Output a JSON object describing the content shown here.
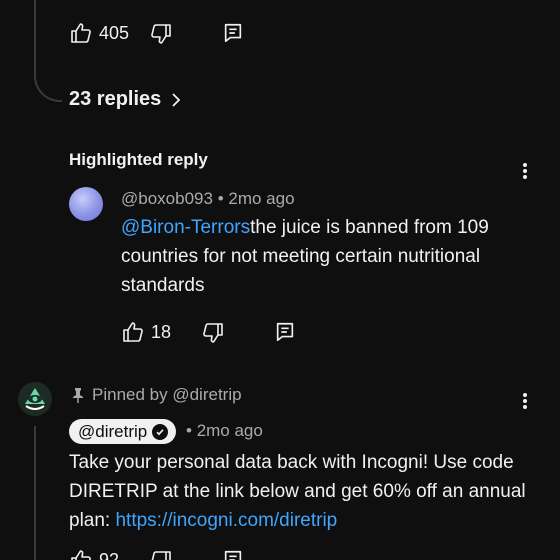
{
  "top_comment": {
    "like_count": "405"
  },
  "replies": {
    "label": "23 replies"
  },
  "highlighted_reply": {
    "heading": "Highlighted reply",
    "author": "@boxob093",
    "time": "2mo ago",
    "mention": "@Biron-Terrors",
    "text": "the juice is banned from 109 countries for not meeting certain nutritional standards",
    "like_count": "18"
  },
  "pinned_comment": {
    "pinned_label": "Pinned by @diretrip",
    "author": "@diretrip",
    "time": "2mo ago",
    "text": "Take your personal data back with Incogni! Use code DIRETRIP at the link below and get 60% off an annual plan: ",
    "link": "https://incogni.com/diretrip",
    "like_count": "92"
  },
  "colors": {
    "background": "#0f0f0f",
    "text": "#f1f1f1",
    "muted": "#aaaaaa",
    "link": "#3ea6ff"
  },
  "icons": [
    "thumbs-up-icon",
    "thumbs-down-icon",
    "reply-icon",
    "chevron-right-icon",
    "more-vert-icon",
    "pin-icon",
    "verified-check-icon"
  ]
}
